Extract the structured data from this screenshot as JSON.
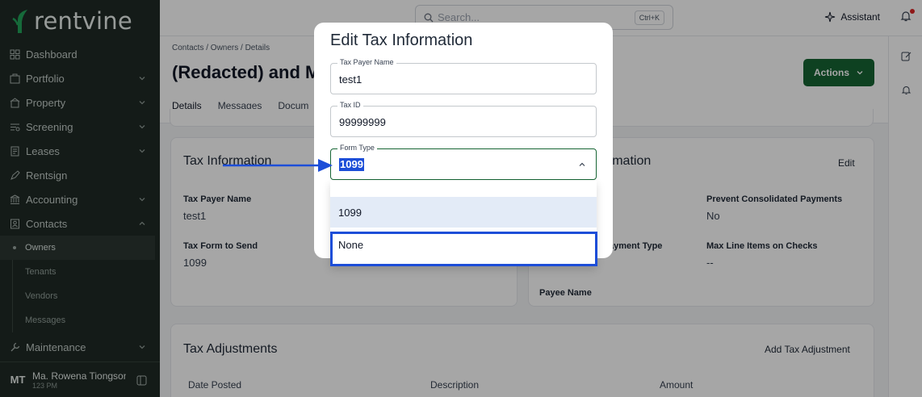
{
  "brand": {
    "name": "rentvine",
    "accent": "#166534"
  },
  "topbar": {
    "search_placeholder": "Search...",
    "search_shortcut": "Ctrl+K",
    "assistant_label": "Assistant"
  },
  "sidebar": {
    "items": [
      {
        "label": "Dashboard",
        "icon": "dashboard-icon"
      },
      {
        "label": "Portfolio",
        "icon": "portfolio-icon"
      },
      {
        "label": "Property",
        "icon": "property-icon"
      },
      {
        "label": "Screening",
        "icon": "screening-icon"
      },
      {
        "label": "Leases",
        "icon": "leases-icon"
      },
      {
        "label": "Rentsign",
        "icon": "rentsign-icon"
      },
      {
        "label": "Accounting",
        "icon": "accounting-icon"
      },
      {
        "label": "Contacts",
        "icon": "contacts-icon"
      }
    ],
    "contacts_sub": [
      "Owners",
      "Tenants",
      "Vendors",
      "Messages"
    ],
    "maintenance_label": "Maintenance",
    "user_initials": "MT",
    "user_name": "Ma. Rowena Tiongson",
    "user_time": "123 PM"
  },
  "page": {
    "breadcrumb": "Contacts  /  Owners  /  Details",
    "title": "(Redacted) and M",
    "tabs": [
      "Details",
      "Messages",
      "Docum"
    ],
    "actions_label": "Actions"
  },
  "tax_card": {
    "title": "Tax Information",
    "payer_label": "Tax Payer Name",
    "payer_value": "test1",
    "form_label": "Tax Form to Send",
    "form_value": "1099"
  },
  "payment_card": {
    "title_partial": "ormation",
    "edit_label": "Edit",
    "consolidated_label": "Prevent Consolidated Payments",
    "consolidated_value": "No",
    "payment_type_partial": "ayment Type",
    "max_lines_label": "Max Line Items on Checks",
    "max_lines_value": "--",
    "payee_label": "Payee Name"
  },
  "adjustments": {
    "title": "Tax Adjustments",
    "add_label": "Add Tax Adjustment",
    "columns": [
      "Date Posted",
      "Description",
      "Amount"
    ]
  },
  "modal": {
    "title": "Edit Tax Information",
    "payer_label": "Tax Payer Name",
    "payer_value": "test1",
    "taxid_label": "Tax ID",
    "taxid_value": "99999999",
    "form_type_label": "Form Type",
    "form_type_value": "1099",
    "options": [
      "1099",
      "None"
    ]
  }
}
